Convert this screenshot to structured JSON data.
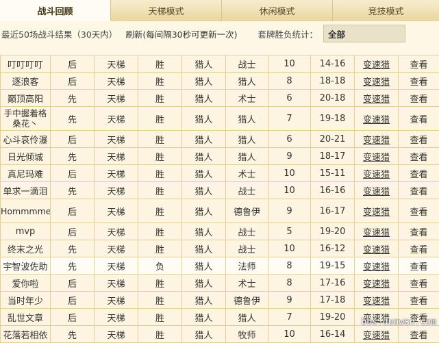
{
  "tabs": [
    "战斗回顾",
    "天梯模式",
    "休闲模式",
    "竞技模式"
  ],
  "filter": {
    "summary": "最近50场战斗结果（30天内）",
    "refresh_label": "刷新",
    "refresh_note": "(每间隔30秒可更新一次)",
    "stats_label": "套牌胜负统计：",
    "selected": "全部"
  },
  "rows": [
    {
      "name": "叮叮叮叮",
      "order": "后",
      "mode": "天梯",
      "result": "胜",
      "my_class": "猎人",
      "opp_class": "战士",
      "turns": "10",
      "score": "14-16",
      "deck": "变速猎",
      "view": "查看"
    },
    {
      "name": "逐浪客",
      "order": "后",
      "mode": "天梯",
      "result": "胜",
      "my_class": "猎人",
      "opp_class": "猎人",
      "turns": "8",
      "score": "18-18",
      "deck": "变速猎",
      "view": "查看"
    },
    {
      "name": "巅顶高阳",
      "order": "先",
      "mode": "天梯",
      "result": "胜",
      "my_class": "猎人",
      "opp_class": "术士",
      "turns": "6",
      "score": "20-18",
      "deck": "变速猎",
      "view": "查看"
    },
    {
      "name": "手中握着格桑花丶",
      "order": "先",
      "mode": "天梯",
      "result": "胜",
      "my_class": "猎人",
      "opp_class": "猎人",
      "turns": "7",
      "score": "19-18",
      "deck": "变速猎",
      "view": "查看"
    },
    {
      "name": "心斗哀伶瀑",
      "order": "后",
      "mode": "天梯",
      "result": "胜",
      "my_class": "猎人",
      "opp_class": "猎人",
      "turns": "6",
      "score": "20-21",
      "deck": "变速猎",
      "view": "查看"
    },
    {
      "name": "日光倾城",
      "order": "先",
      "mode": "天梯",
      "result": "胜",
      "my_class": "猎人",
      "opp_class": "猎人",
      "turns": "9",
      "score": "18-17",
      "deck": "变速猎",
      "view": "查看"
    },
    {
      "name": "真尼玛难",
      "order": "后",
      "mode": "天梯",
      "result": "胜",
      "my_class": "猎人",
      "opp_class": "术士",
      "turns": "10",
      "score": "15-11",
      "deck": "变速猎",
      "view": "查看"
    },
    {
      "name": "单求一滴泪",
      "order": "先",
      "mode": "天梯",
      "result": "胜",
      "my_class": "猎人",
      "opp_class": "战士",
      "turns": "10",
      "score": "16-16",
      "deck": "变速猎",
      "view": "查看"
    },
    {
      "name": "Hommmme",
      "order": "后",
      "mode": "天梯",
      "result": "胜",
      "my_class": "猎人",
      "opp_class": "德鲁伊",
      "turns": "9",
      "score": "16-17",
      "deck": "变速猎",
      "view": "查看"
    },
    {
      "name": "mvp",
      "order": "后",
      "mode": "天梯",
      "result": "胜",
      "my_class": "猎人",
      "opp_class": "战士",
      "turns": "5",
      "score": "19-20",
      "deck": "变速猎",
      "view": "查看"
    },
    {
      "name": "终末之光",
      "order": "先",
      "mode": "天梯",
      "result": "胜",
      "my_class": "猎人",
      "opp_class": "战士",
      "turns": "10",
      "score": "16-12",
      "deck": "变速猎",
      "view": "查看"
    },
    {
      "name": "宇智波佐助",
      "order": "先",
      "mode": "天梯",
      "result": "负",
      "my_class": "猎人",
      "opp_class": "法师",
      "turns": "8",
      "score": "19-15",
      "deck": "变速猎",
      "view": "查看"
    },
    {
      "name": "爱你啦",
      "order": "后",
      "mode": "天梯",
      "result": "胜",
      "my_class": "猎人",
      "opp_class": "术士",
      "turns": "8",
      "score": "17-16",
      "deck": "变速猎",
      "view": "查看"
    },
    {
      "name": "当时年少",
      "order": "后",
      "mode": "天梯",
      "result": "胜",
      "my_class": "猎人",
      "opp_class": "德鲁伊",
      "turns": "9",
      "score": "17-18",
      "deck": "变速猎",
      "view": "查看"
    },
    {
      "name": "乱世文章",
      "order": "后",
      "mode": "天梯",
      "result": "胜",
      "my_class": "猎人",
      "opp_class": "猎人",
      "turns": "7",
      "score": "19-20",
      "deck": "变速猎",
      "view": "查看"
    },
    {
      "name": "花落若相依",
      "order": "先",
      "mode": "天梯",
      "result": "胜",
      "my_class": "猎人",
      "opp_class": "牧师",
      "turns": "10",
      "score": "16-14",
      "deck": "变速猎",
      "view": "查看"
    }
  ],
  "watermark": "bbs.duowan.com"
}
